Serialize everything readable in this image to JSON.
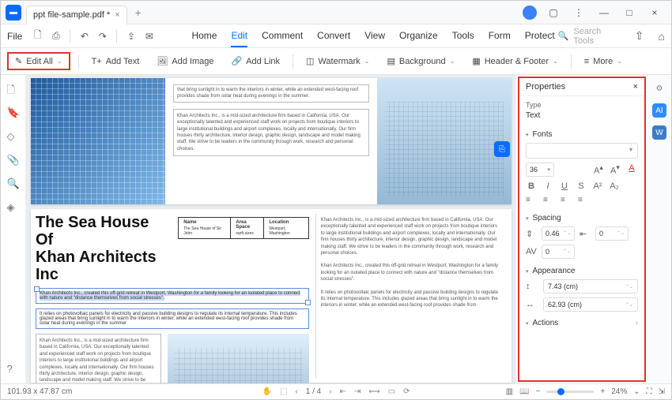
{
  "titlebar": {
    "tab_name": "ppt file-sample.pdf *"
  },
  "menubar": {
    "file": "File",
    "tabs": [
      "Home",
      "Edit",
      "Comment",
      "Convert",
      "View",
      "Organize",
      "Tools",
      "Form",
      "Protect"
    ],
    "active_tab_index": 1,
    "search_placeholder": "Search Tools"
  },
  "toolbar": {
    "edit_all": "Edit All",
    "add_text": "Add Text",
    "add_image": "Add Image",
    "add_link": "Add Link",
    "watermark": "Watermark",
    "background": "Background",
    "header_footer": "Header & Footer",
    "more": "More"
  },
  "doc": {
    "top_line": "that bring sunlight in to warm the interiors in winter, while an extended west-facing roof provides shade from solar heat during evenings in the summer.",
    "mid_para": "Khan Architects Inc., is a mid-sized architecture firm based in California, USA. Our exceptionally talented and experienced staff work on projects from boutique interiors to large institutional buildings and airport complexes, locally and internationally. Our firm houses thirty architecture, interior design, graphic design, landscape and model making staff. We strive to be leaders in the community through work, research and personal choices.",
    "title_line1": "The Sea House Of",
    "title_line2": "Khan Architects Inc",
    "table": {
      "name_h": "Name",
      "name_v": "The Sea House of Sir John",
      "area_h": "Area Space",
      "area_v": "sqrft.sizes",
      "loc_h": "Location",
      "loc_v": "Westport, Washington"
    },
    "sel_line1": "Khan Architects Inc., created this off-grid retreat in Westport, Washington for a family looking for an isolated place to connect with nature and \"distance themselves from social stresses\".",
    "sel_line2": "It relies on photovoltaic panels for electricity and passive building designs to regulate its internal temperature. This includes glazed areas that bring sunlight in to warm the interiors in winter, while an extended west-facing roof provides shade from solar heat during evenings in the summer",
    "right_p1": "Khan Architects Inc., is a mid-sized architecture firm based in California, USA. Our exceptionally talented and experienced staff work on projects from boutique interiors to large institutional buildings and airport complexes, locally and internationally. Our firm houses thirty architecture, interior design, graphic design, landscape and model making staff. We strive to be leaders in the community through work, research and personal choices.",
    "right_p2": "Khan Architects Inc., created this off-grid retreat in Westport, Washington for a family looking for an isolated place to connect with nature and \"distance themselves from social stresses\".",
    "right_p3": "It relies on photovoltaic panels for electricity and passive building designs to regulate its internal temperature. This includes glazed areas that bring sunlight in to warm the interiors in winter, while an extended west-facing roof provides shade from"
  },
  "properties": {
    "title": "Properties",
    "type_label": "Type",
    "type_value": "Text",
    "fonts_label": "Fonts",
    "font_size": "36",
    "spacing_label": "Spacing",
    "line_spacing": "0.46",
    "indent": "0",
    "char_spacing": "0",
    "appearance_label": "Appearance",
    "height": "7.43 (cm)",
    "width": "62.93 (cm)",
    "actions_label": "Actions"
  },
  "statusbar": {
    "coords": "101.93 x 47.87 cm",
    "page": "1 / 4",
    "zoom": "24%"
  }
}
